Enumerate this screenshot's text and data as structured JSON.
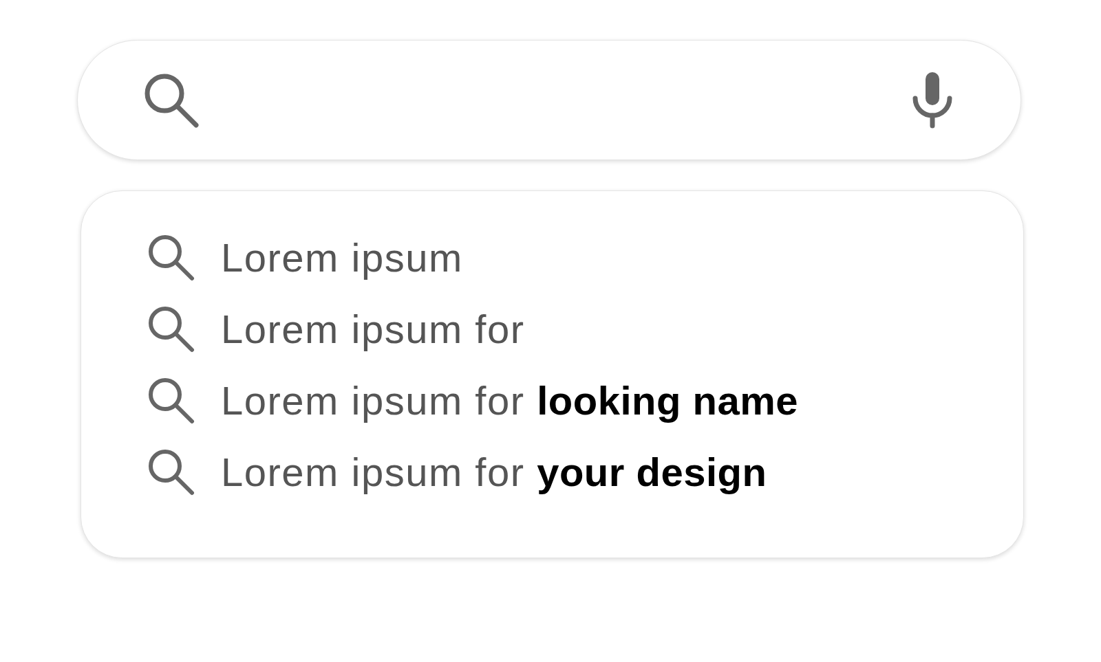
{
  "suggestions": [
    {
      "text": "Lorem ipsum"
    },
    {
      "text": "Lorem ipsum for"
    },
    {
      "text": "Lorem ipsum for **looking name**"
    },
    {
      "text": "Lorem ipsum for **your design**"
    }
  ]
}
